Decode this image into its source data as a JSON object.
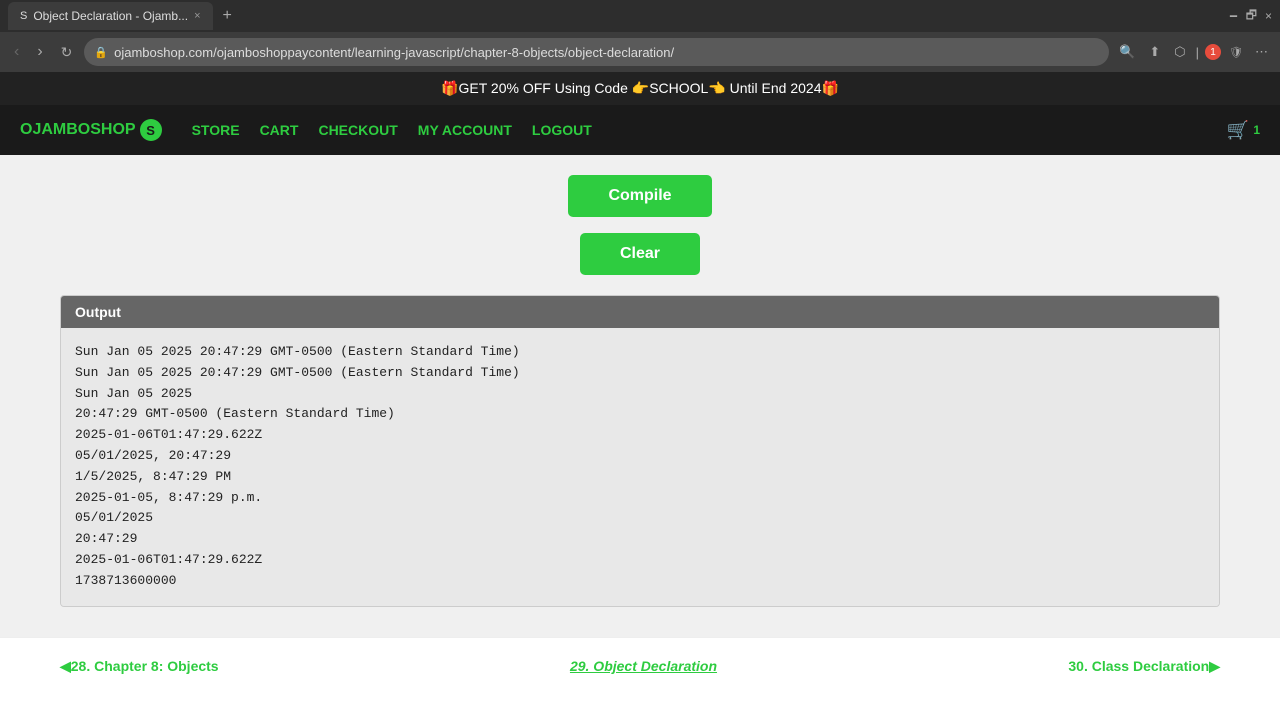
{
  "browser": {
    "tab_favicon": "S",
    "tab_title": "Object Declaration - Ojamb...",
    "tab_close": "×",
    "tab_new": "+",
    "tab_controls": [
      "🗕",
      "🗗",
      "×"
    ],
    "url": "ojamboshop.com/ojamboshoppaycontent/learning-javascript/chapter-8-objects/object-declaration/",
    "toolbar_icons": [
      "🔍",
      "⬆",
      "⬡",
      "⋯"
    ],
    "notification_count": "1",
    "extension_icon": "🛡"
  },
  "promo": {
    "text": "🎁GET 20% OFF Using Code 👉SCHOOL👈 Until End 2024🎁"
  },
  "nav": {
    "logo_text": "OJAMBOSHOP",
    "logo_letter": "S",
    "links": [
      {
        "label": "STORE",
        "href": "#"
      },
      {
        "label": "CART",
        "href": "#"
      },
      {
        "label": "CHECKOUT",
        "href": "#"
      },
      {
        "label": "MY ACCOUNT",
        "href": "#"
      },
      {
        "label": "LOGOUT",
        "href": "#"
      }
    ],
    "cart_icon": "🛒",
    "cart_count": "1"
  },
  "main": {
    "compile_label": "Compile",
    "clear_label": "Clear",
    "output_header": "Output",
    "output_lines": [
      "Sun Jan 05 2025 20:47:29 GMT-0500 (Eastern Standard Time)",
      "Sun Jan 05 2025 20:47:29 GMT-0500 (Eastern Standard Time)",
      "Sun Jan 05 2025",
      "20:47:29 GMT-0500 (Eastern Standard Time)",
      "2025-01-06T01:47:29.622Z",
      "05/01/2025, 20:47:29",
      "1/5/2025, 8:47:29 PM",
      "2025-01-05, 8:47:29 p.m.",
      "05/01/2025",
      "20:47:29",
      "2025-01-06T01:47:29.622Z",
      "1738713600000"
    ]
  },
  "bottom_nav": {
    "prev_label": "◀28. Chapter 8: Objects",
    "current_label": "29. Object Declaration",
    "next_label": "30. Class Declaration▶"
  }
}
